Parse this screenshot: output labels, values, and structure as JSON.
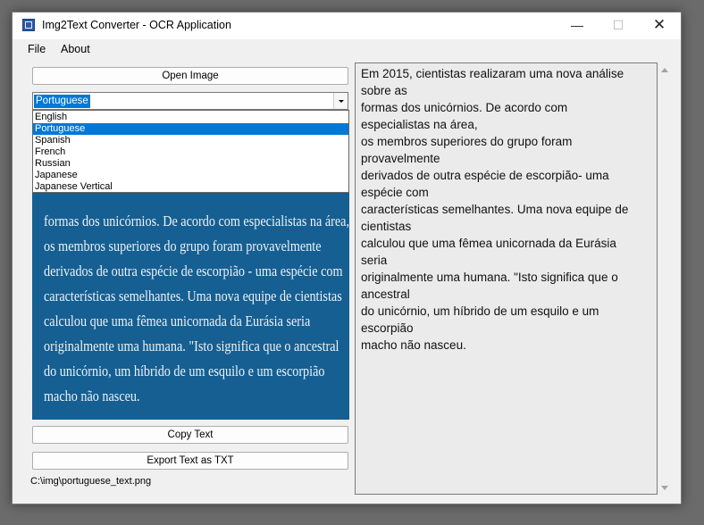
{
  "window": {
    "title": "Img2Text Converter - OCR Application",
    "controls": {
      "minimize": "—",
      "maximize": "☐",
      "close": "✕"
    }
  },
  "menu": {
    "file": "File",
    "about": "About"
  },
  "buttons": {
    "open_image": "Open Image",
    "copy_text": "Copy Text",
    "export_text": "Export Text as TXT"
  },
  "language": {
    "selected": "Portuguese",
    "options": [
      "English",
      "Portuguese",
      "Spanish",
      "French",
      "Russian",
      "Japanese",
      "Japanese Vertical"
    ]
  },
  "image_preview": {
    "lines": [
      "formas dos unicórnios. De acordo com especialistas na área,",
      "os membros superiores do grupo foram provavelmente",
      "derivados de outra espécie de escorpião - uma espécie com",
      "características semelhantes. Uma nova equipe de cientistas",
      "calculou que uma fêmea unicornada da Eurásia seria",
      "originalmente uma humana. \"Isto significa que o ancestral",
      "do unicórnio, um híbrido de um esquilo e um escorpião",
      "macho não nasceu."
    ],
    "background": "#155f92"
  },
  "file_path": "C:\\img\\portuguese_text.png",
  "ocr_text": {
    "lines": [
      "Em 2015, cientistas realizaram uma nova análise",
      "sobre as",
      "formas dos unicórnios. De acordo com",
      "especialistas na área,",
      "os membros superiores do grupo foram",
      "provavelmente",
      "derivados de outra espécie de escorpião- uma",
      "espécie com",
      "características semelhantes. Uma nova equipe de",
      "cientistas",
      "calculou que uma fêmea unicornada da Eurásia",
      "seria",
      "originalmente uma humana. \"Isto significa que o",
      "ancestral",
      "do unicórnio, um híbrido de um esquilo e um",
      "escorpião",
      "macho não nasceu."
    ]
  },
  "colors": {
    "accent": "#0078d7",
    "window_bg": "#f0f0f0",
    "text_area_bg": "#ebebeb"
  }
}
